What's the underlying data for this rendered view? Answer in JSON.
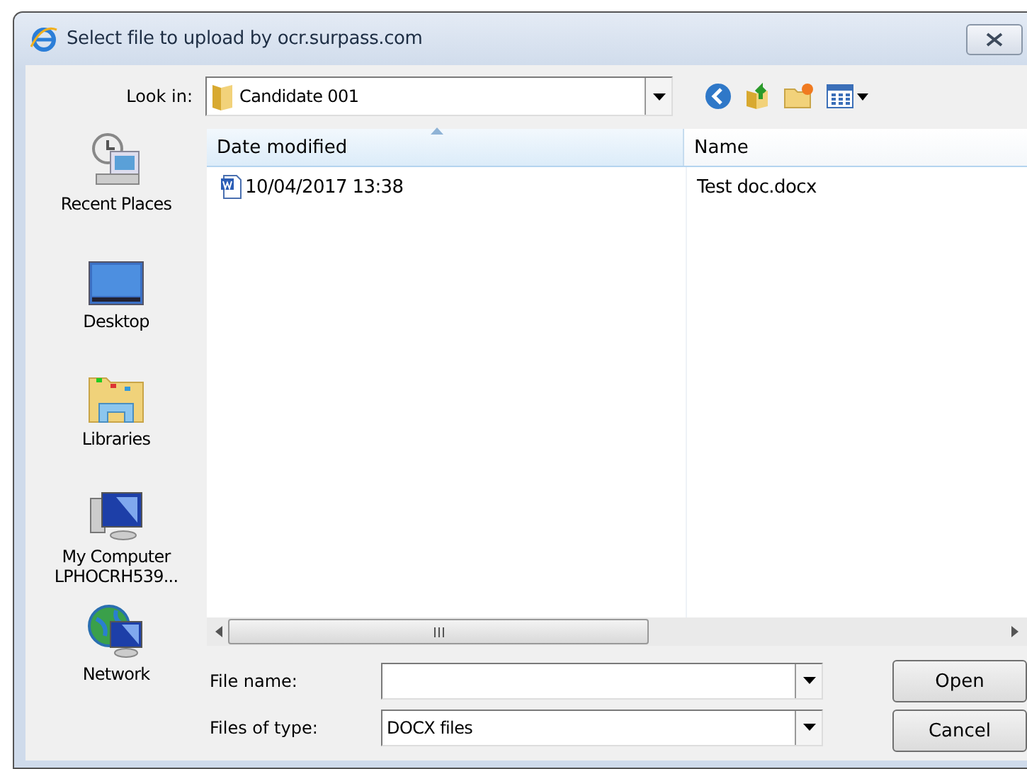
{
  "window": {
    "title": "Select file to upload by ocr.surpass.com"
  },
  "look_in": {
    "label": "Look in:",
    "value": "Candidate 001"
  },
  "places": [
    {
      "kind": "recent",
      "label": "Recent Places"
    },
    {
      "kind": "desktop",
      "label": "Desktop"
    },
    {
      "kind": "libraries",
      "label": "Libraries"
    },
    {
      "kind": "computer",
      "label": "My Computer\nLPHOCRH539..."
    },
    {
      "kind": "network",
      "label": "Network"
    }
  ],
  "table": {
    "columns": [
      {
        "label": "Date modified",
        "sorted": true
      },
      {
        "label": "Name",
        "sorted": false
      }
    ],
    "rows": [
      {
        "cells": [
          "10/04/2017 13:38",
          "Test doc.docx"
        ]
      }
    ]
  },
  "file_name": {
    "label": "File name:"
  },
  "file_type": {
    "label": "Files of type:",
    "value": "DOCX files"
  },
  "buttons": [
    "Open",
    "Cancel"
  ]
}
